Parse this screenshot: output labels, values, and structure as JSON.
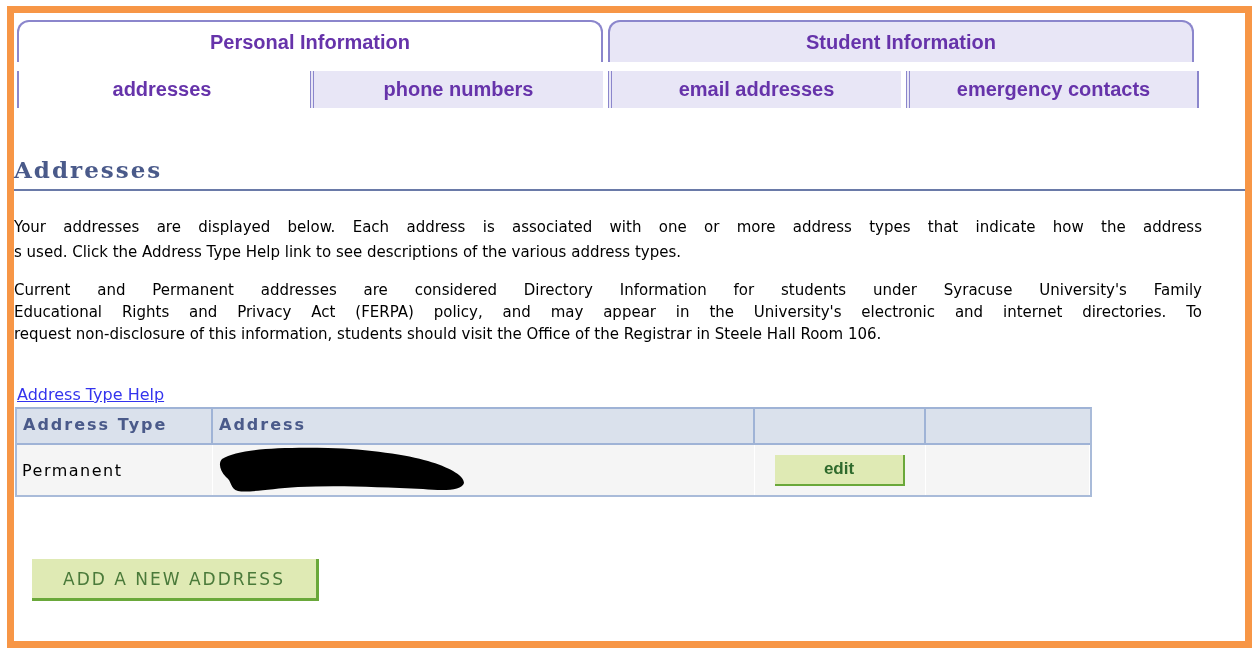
{
  "tabs": [
    {
      "label": "Personal Information",
      "selected": true
    },
    {
      "label": "Student Information",
      "selected": false
    }
  ],
  "subtabs": [
    {
      "label": "addresses",
      "selected": true
    },
    {
      "label": "phone numbers",
      "selected": false
    },
    {
      "label": "email addresses",
      "selected": false
    },
    {
      "label": "emergency contacts",
      "selected": false
    }
  ],
  "heading": "Addresses",
  "paragraphs": [
    {
      "lines": [
        "Your addresses are displayed below. Each address is associated with one or more address types that indicate how the address",
        "s used. Click the Address Type Help link to see descriptions of the various address types."
      ]
    },
    {
      "lines": [
        "Current and Permanent addresses are considered Directory Information for students under Syracuse University's Family",
        "Educational Rights and Privacy Act (FERPA) policy, and may appear in the University's electronic and internet directories. To",
        "request non-disclosure of this information, students should visit the Office of the Registrar in Steele Hall Room 106."
      ]
    }
  ],
  "help_link": "Address Type Help",
  "table": {
    "columns": [
      "Address Type",
      "Address"
    ],
    "rows": [
      {
        "address_type": "Permanent",
        "address_redacted": true,
        "action": "edit"
      }
    ]
  },
  "add_button": "ADD A NEW ADDRESS"
}
